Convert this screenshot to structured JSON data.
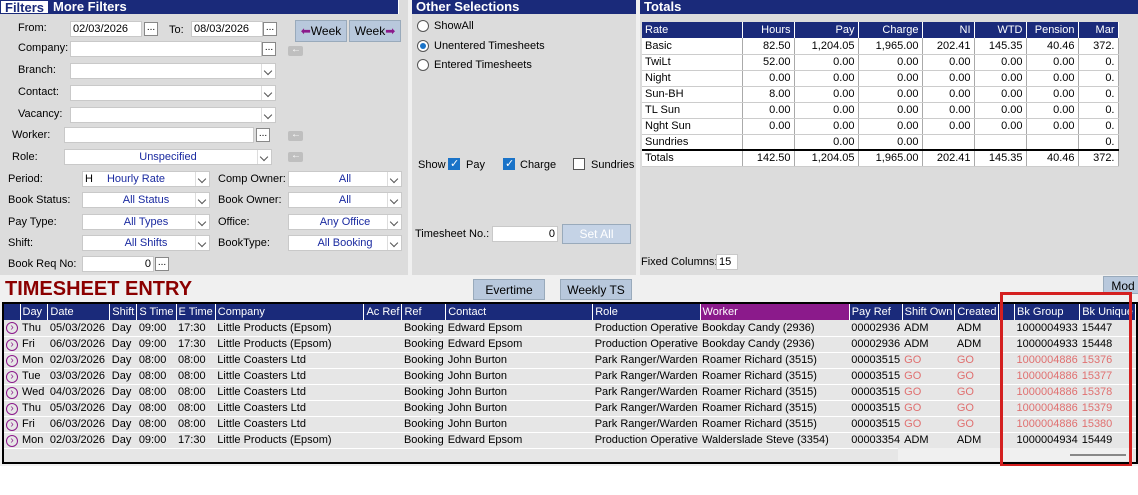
{
  "tabs": [
    "Filters",
    "More Filters"
  ],
  "filters": {
    "from_label": "From:",
    "from_value": "02/03/2026",
    "to_label": "To:",
    "to_value": "08/03/2026",
    "week_prev": "Week",
    "week_next": "Week",
    "company_label": "Company:",
    "branch_label": "Branch:",
    "contact_label": "Contact:",
    "vacancy_label": "Vacancy:",
    "worker_label": "Worker:",
    "role_label": "Role:",
    "role_value": "Unspecified",
    "period_label": "Period:",
    "period_code": "H",
    "period_value": "Hourly Rate",
    "comp_owner_label": "Comp Owner:",
    "comp_owner_value": "All",
    "book_status_label": "Book Status:",
    "book_status_value": "All Status",
    "book_owner_label": "Book Owner:",
    "book_owner_value": "All",
    "pay_type_label": "Pay Type:",
    "pay_type_value": "All Types",
    "office_label": "Office:",
    "office_value": "Any Office",
    "shift_label": "Shift:",
    "shift_value": "All Shifts",
    "book_type_label": "BookType:",
    "book_type_value": "All Booking",
    "book_req_label": "Book Req No:",
    "book_req_value": "0"
  },
  "other": {
    "title": "Other Selections",
    "show_all": "ShowAll",
    "unentered": "Unentered Timesheets",
    "entered": "Entered Timesheets",
    "show_label": "Show",
    "pay": "Pay",
    "charge": "Charge",
    "sundries": "Sundries",
    "ts_no_label": "Timesheet No.:",
    "ts_no_value": "0",
    "set_all": "Set All"
  },
  "totals": {
    "title": "Totals",
    "headers": [
      "Rate",
      "Hours",
      "Pay",
      "Charge",
      "NI",
      "WTD",
      "Pension",
      "Mar"
    ],
    "rows": [
      [
        "Basic",
        "82.50",
        "1,204.05",
        "1,965.00",
        "202.41",
        "145.35",
        "40.46",
        "372."
      ],
      [
        "TwiLt",
        "52.00",
        "0.00",
        "0.00",
        "0.00",
        "0.00",
        "0.00",
        "0."
      ],
      [
        "Night",
        "0.00",
        "0.00",
        "0.00",
        "0.00",
        "0.00",
        "0.00",
        "0."
      ],
      [
        "Sun-BH",
        "8.00",
        "0.00",
        "0.00",
        "0.00",
        "0.00",
        "0.00",
        "0."
      ],
      [
        "TL Sun",
        "0.00",
        "0.00",
        "0.00",
        "0.00",
        "0.00",
        "0.00",
        "0."
      ],
      [
        "Nght Sun",
        "0.00",
        "0.00",
        "0.00",
        "0.00",
        "0.00",
        "0.00",
        "0."
      ],
      [
        "Sundries",
        "",
        "0.00",
        "0.00",
        "",
        "",
        "",
        "0."
      ]
    ],
    "total_row": [
      "Totals",
      "142.50",
      "1,204.05",
      "1,965.00",
      "202.41",
      "145.35",
      "40.46",
      "372."
    ],
    "fixed_cols_label": "Fixed Columns:",
    "fixed_cols_value": "15"
  },
  "entry": {
    "title": "TIMESHEET ENTRY",
    "evertime": "Evertime",
    "weekly_ts": "Weekly TS",
    "mod": "Mod",
    "headers": [
      "",
      "Day",
      "Date",
      "Shift",
      "S Time",
      "E Time",
      "Company",
      "Ac Ref",
      "Ref",
      "Contact",
      "Role",
      "Worker",
      "Pay Ref",
      "Shift Own",
      "Created",
      "",
      "Bk Group",
      "Bk Unique"
    ],
    "rows": [
      {
        "cells": [
          "Thu",
          "05/03/2026",
          "Day",
          "09:00",
          "17:30",
          "Little Products (Epsom)",
          "",
          "Booking",
          "Edward Epsom",
          "Production Operative",
          "Bookday Candy (2936)",
          "00002936",
          "ADM",
          "ADM",
          "",
          "1000004933",
          "15447"
        ],
        "pink": false
      },
      {
        "cells": [
          "Fri",
          "06/03/2026",
          "Day",
          "09:00",
          "17:30",
          "Little Products (Epsom)",
          "",
          "Booking",
          "Edward Epsom",
          "Production Operative",
          "Bookday Candy (2936)",
          "00002936",
          "ADM",
          "ADM",
          "",
          "1000004933",
          "15448"
        ],
        "pink": false
      },
      {
        "cells": [
          "Mon",
          "02/03/2026",
          "Day",
          "08:00",
          "08:00",
          "Little Coasters Ltd",
          "",
          "Booking",
          "John Burton",
          "Park Ranger/Warden",
          "Roamer Richard (3515)",
          "00003515",
          "GO",
          "GO",
          "",
          "1000004886",
          "15376"
        ],
        "pink": true
      },
      {
        "cells": [
          "Tue",
          "03/03/2026",
          "Day",
          "08:00",
          "08:00",
          "Little Coasters Ltd",
          "",
          "Booking",
          "John Burton",
          "Park Ranger/Warden",
          "Roamer Richard (3515)",
          "00003515",
          "GO",
          "GO",
          "",
          "1000004886",
          "15377"
        ],
        "pink": true
      },
      {
        "cells": [
          "Wed",
          "04/03/2026",
          "Day",
          "08:00",
          "08:00",
          "Little Coasters Ltd",
          "",
          "Booking",
          "John Burton",
          "Park Ranger/Warden",
          "Roamer Richard (3515)",
          "00003515",
          "GO",
          "GO",
          "",
          "1000004886",
          "15378"
        ],
        "pink": true
      },
      {
        "cells": [
          "Thu",
          "05/03/2026",
          "Day",
          "08:00",
          "08:00",
          "Little Coasters Ltd",
          "",
          "Booking",
          "John Burton",
          "Park Ranger/Warden",
          "Roamer Richard (3515)",
          "00003515",
          "GO",
          "GO",
          "",
          "1000004886",
          "15379"
        ],
        "pink": true
      },
      {
        "cells": [
          "Fri",
          "06/03/2026",
          "Day",
          "08:00",
          "08:00",
          "Little Coasters Ltd",
          "",
          "Booking",
          "John Burton",
          "Park Ranger/Warden",
          "Roamer Richard (3515)",
          "00003515",
          "GO",
          "GO",
          "",
          "1000004886",
          "15380"
        ],
        "pink": true
      },
      {
        "cells": [
          "Mon",
          "02/03/2026",
          "Day",
          "09:00",
          "17:30",
          "Little Products (Epsom)",
          "",
          "Booking",
          "Edward Epsom",
          "Production Operative",
          "Walderslade Steve (3354)",
          "00003354",
          "ADM",
          "ADM",
          "",
          "1000004934",
          "15449"
        ],
        "pink": false
      }
    ]
  },
  "colors": {
    "header_blue": "#1a2a7a",
    "worker_purple": "#8b1a8b",
    "title_red": "#8b0000",
    "highlight": "#d42020",
    "pink_text": "#e07070"
  }
}
